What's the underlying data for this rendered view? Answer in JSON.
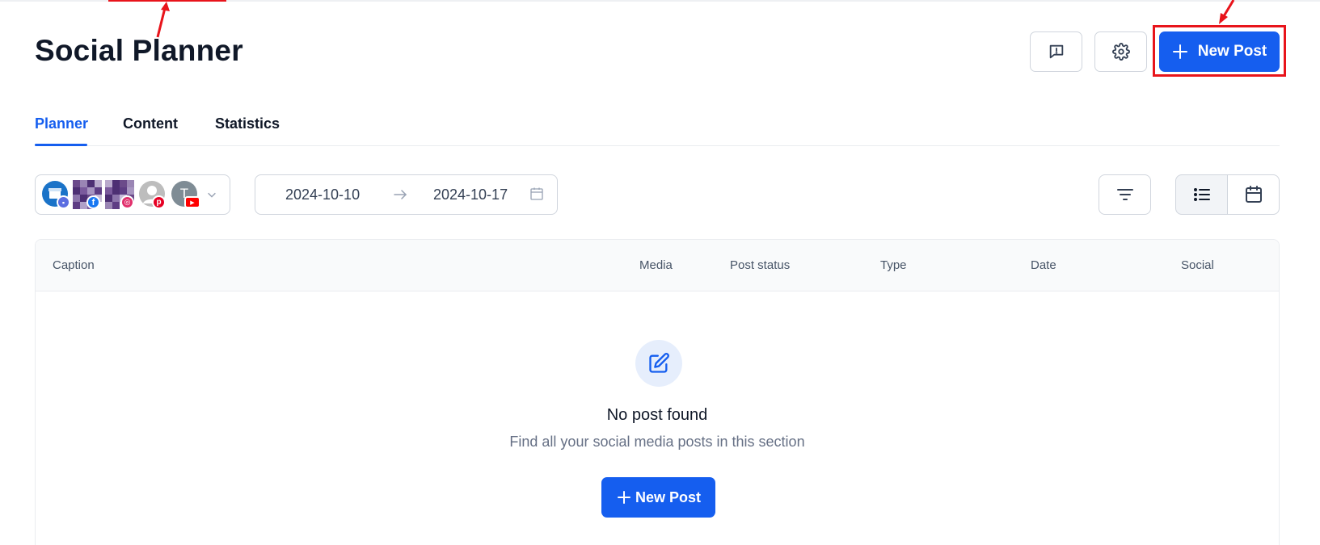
{
  "page": {
    "title": "Social Planner"
  },
  "header": {
    "new_post_label": "New Post"
  },
  "tabs": [
    {
      "label": "Planner",
      "active": true
    },
    {
      "label": "Content",
      "active": false
    },
    {
      "label": "Statistics",
      "active": false
    }
  ],
  "accounts": {
    "avatars": [
      {
        "kind": "google-business",
        "badge": "gmb"
      },
      {
        "kind": "pixelated",
        "badge": "facebook"
      },
      {
        "kind": "pixelated",
        "badge": "instagram"
      },
      {
        "kind": "default-user",
        "badge": "pinterest"
      },
      {
        "kind": "initial",
        "initial": "T",
        "badge": "youtube"
      }
    ]
  },
  "date_range": {
    "start": "2024-10-10",
    "end": "2024-10-17"
  },
  "table": {
    "columns": [
      "Caption",
      "Media",
      "Post status",
      "Type",
      "Date",
      "Social"
    ]
  },
  "empty_state": {
    "icon": "edit-icon",
    "title": "No post found",
    "subtitle": "Find all your social media posts in this section",
    "button_label": "New Post"
  },
  "colors": {
    "primary": "#155eef",
    "annotation": "#e8141b",
    "facebook": "#1877f2",
    "instagram": "#e1306c",
    "pinterest": "#e60023",
    "youtube": "#ff0000"
  }
}
